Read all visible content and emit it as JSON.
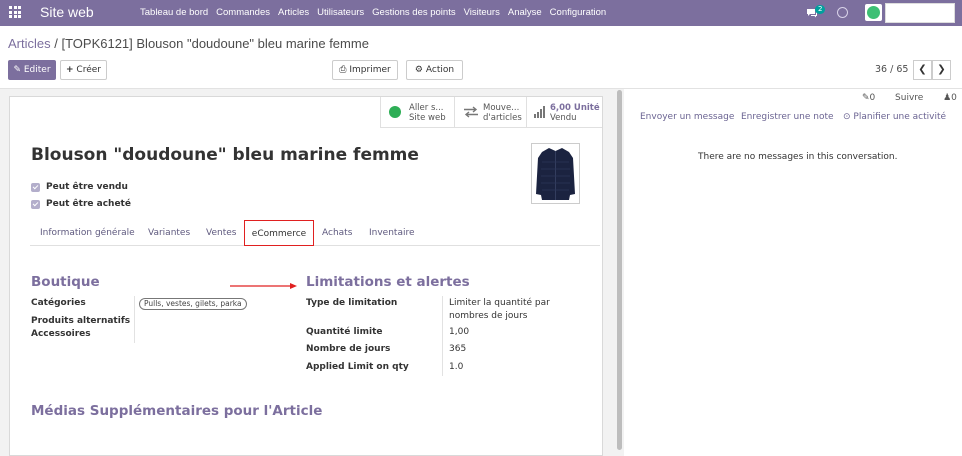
{
  "navbar": {
    "app_name": "Site web",
    "menu": [
      "Tableau de bord",
      "Commandes",
      "Articles",
      "Utilisateurs",
      "Gestions des points",
      "Visiteurs",
      "Analyse",
      "Configuration"
    ],
    "chat_count": "2",
    "icons": [
      "apps-grid-icon",
      "chat-icon",
      "clock-icon",
      "avatar"
    ]
  },
  "breadcrumb": {
    "parent": "Articles",
    "separator": " / ",
    "current": "[TOPK6121] Blouson \"doudoune\" bleu marine femme"
  },
  "toolbar": {
    "edit": "Editer",
    "create": "Créer",
    "print": "Imprimer",
    "action": "Action"
  },
  "pager": {
    "value": "36 / 65"
  },
  "smart_buttons": [
    {
      "line1": "Aller s...",
      "line2": "Site web"
    },
    {
      "line1": "Mouve...",
      "line2": "d'articles"
    },
    {
      "line1": "6,00 Unité",
      "line2": "Vendu"
    }
  ],
  "product": {
    "title": "Blouson \"doudoune\" bleu marine femme",
    "can_be_sold": "Peut être vendu",
    "can_be_purchased": "Peut être acheté"
  },
  "tabs": [
    "Information générale",
    "Variantes",
    "Ventes",
    "eCommerce",
    "Achats",
    "Inventaire"
  ],
  "active_tab": "eCommerce",
  "boutique": {
    "title": "Boutique",
    "categories_label": "Catégories",
    "categories_tag": "Pulls, vestes, gilets, parka",
    "alternative_label": "Produits alternatifs",
    "accessories_label": "Accessoires"
  },
  "limits": {
    "title": "Limitations et alertes",
    "rows": [
      {
        "label": "Type de limitation",
        "value_line1": "Limiter la quantité par",
        "value_line2": "nombres de jours"
      },
      {
        "label": "Quantité limite",
        "value_line1": "1,00"
      },
      {
        "label": "Nombre de jours",
        "value_line1": "365"
      },
      {
        "label": "Applied Limit on qty",
        "value_line1": "1.0"
      }
    ]
  },
  "media": {
    "title": "Médias Supplémentaires pour l'Article"
  },
  "chatter": {
    "attachments": "0",
    "follow": "Suivre",
    "followers": "0",
    "send_message": "Envoyer un message",
    "log_note": "Enregistrer une note",
    "schedule": "Planifier une activité",
    "empty": "There are no messages in this conversation."
  },
  "colors": {
    "brand": "#7c6f9e",
    "highlight": "#e02020",
    "success": "#2eae56"
  }
}
